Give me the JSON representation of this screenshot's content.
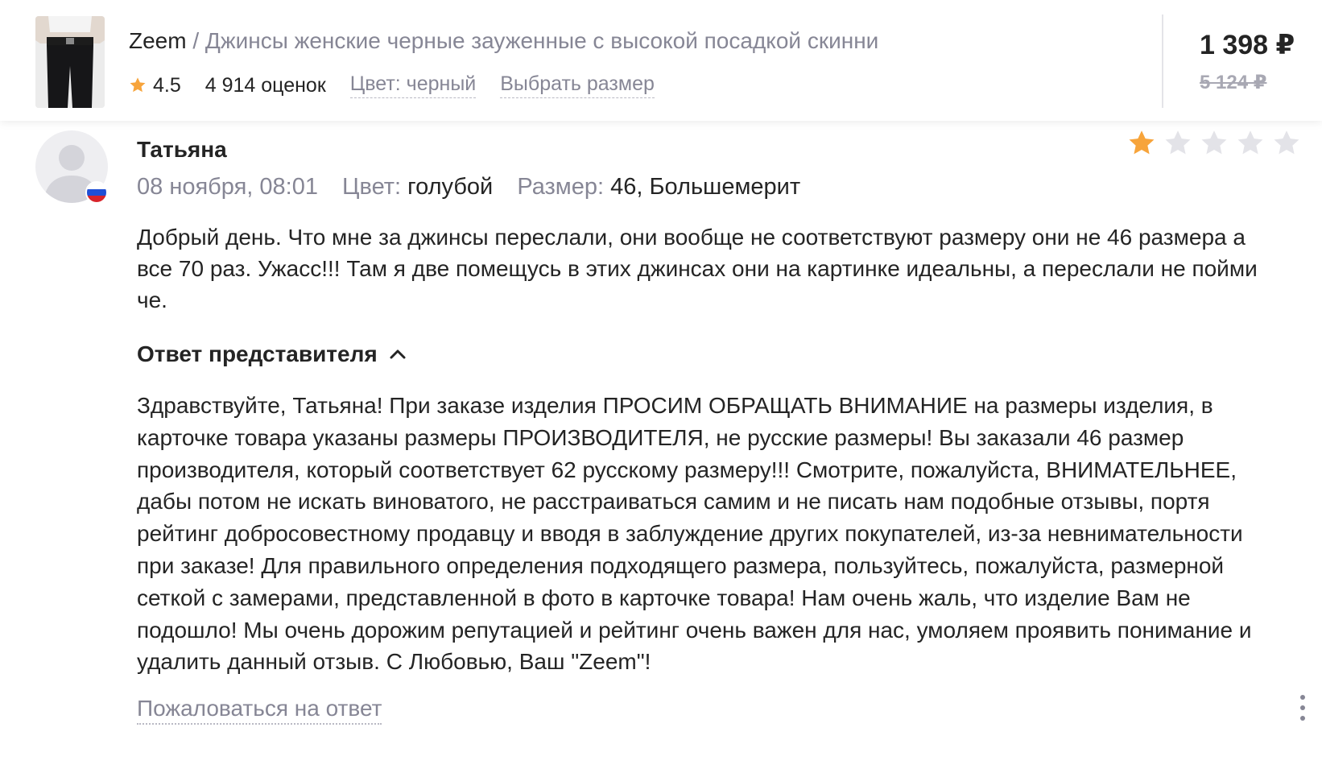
{
  "product": {
    "brand": "Zeem",
    "separator": " / ",
    "name": "Джинсы женские черные зауженные с высокой посадкой скинни",
    "rating": "4.5",
    "reviews_count": "4 914 оценок",
    "color": "Цвет: черный",
    "size_link": "Выбрать размер",
    "price": "1 398 ₽",
    "old_price": "5 124 ₽"
  },
  "review": {
    "author": "Татьяна",
    "date": "08 ноября, 08:01",
    "color_label": "Цвет:",
    "color_value": "голубой",
    "size_label": "Размер:",
    "size_value": "46, Большемерит",
    "rating": 1,
    "rating_max": 5,
    "text": "Добрый день. Что мне за джинсы переслали, они вообще не соответствуют размеру они не 46 размера а все 70 раз. Ужасс!!! Там я две помещусь в этих джинсах они на картинке идеальны, а переслали не пойми че."
  },
  "reply": {
    "toggle_label": "Ответ представителя",
    "text": "Здравствуйте, Татьяна! При заказе изделия ПРОСИМ ОБРАЩАТЬ ВНИМАНИЕ на размеры изделия, в карточке товара указаны размеры ПРОИЗВОДИТЕЛЯ, не русские размеры! Вы заказали 46 размер производителя, который соответствует 62 русскому размеру!!! Смотрите, пожалуйста, ВНИМАТЕЛЬНЕЕ, дабы потом не искать виноватого, не расстраиваться самим и не писать нам подобные отзывы, портя рейтинг добросовестному продавцу и вводя в заблуждение других покупателей, из-за невнимательности при заказе! Для правильного определения подходящего размера, пользуйтесь, пожалуйста, размерной сеткой с замерами, представленной в фото в карточке товара! Нам очень жаль, что изделие Вам не подошло! Мы очень дорожим репутацией и рейтинг очень важен для нас, умоляем проявить понимание и удалить данный отзыв. С Любовью, Ваш \"Zeem\"!",
    "report_label": "Пожаловаться на ответ"
  },
  "colors": {
    "star_active": "#f7a43b",
    "star_inactive": "#e3e3e8",
    "muted_text": "#868695",
    "main_text": "#242424"
  },
  "icons": {
    "rating": "star-icon",
    "avatar": "user-avatar-icon",
    "flag": "russia-flag-icon",
    "toggle": "chevron-up-icon",
    "menu": "more-vertical-icon"
  }
}
